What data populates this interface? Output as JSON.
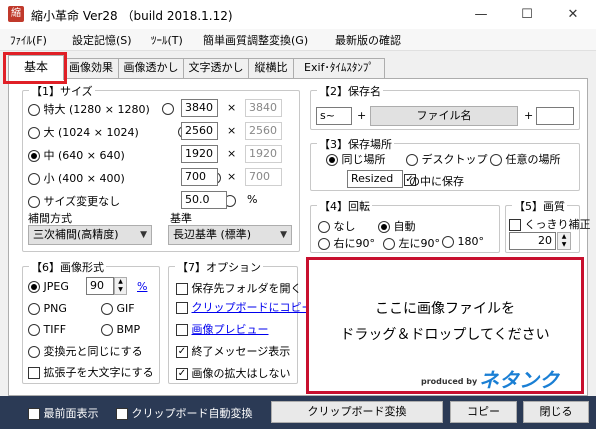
{
  "title": "縮小革命 Ver28 （build 2018.1.12)",
  "app_icon": "縮",
  "window_controls": {
    "minimize": "—",
    "maximize": "☐",
    "close": "✕"
  },
  "menu": [
    "ﾌｧｲﾙ(F)",
    "設定記憶(S)",
    "ﾂｰﾙ(T)",
    "簡単画質調整変換(G)",
    "最新版の確認"
  ],
  "tabs": [
    "基本",
    "画像効果",
    "画像透かし",
    "文字透かし",
    "縦横比",
    "Exif･ﾀｲﾑｽﾀﾝﾌﾟ"
  ],
  "size": {
    "title": "【1】サイズ",
    "presets": [
      "特大 (1280 × 1280)",
      "大 (1024 × 1024)",
      "中 (640 × 640)",
      "小 (400 × 400)",
      "サイズ変更なし"
    ],
    "selected_index": 2,
    "widths": [
      "3840",
      "2560",
      "1920",
      "700"
    ],
    "heights": [
      "3840",
      "2560",
      "1920",
      "700"
    ],
    "percent": "50.0",
    "times": "×",
    "percent_sign": "%"
  },
  "interp": {
    "title": "補間方式",
    "value": "三次補間(高精度)"
  },
  "basis": {
    "title": "基準",
    "value": "長辺基準 (標準)"
  },
  "save_name": {
    "title": "【2】保存名",
    "prefix": "s~",
    "plus": "+",
    "filename": "ファイル名",
    "suffix": ""
  },
  "save_place": {
    "title": "【3】保存場所",
    "options": [
      "同じ場所",
      "デスクトップ",
      "任意の場所"
    ],
    "selected_index": 0,
    "subfolder": "Resized",
    "subfolder_suffix": "の中に保存",
    "subfolder_checked": true
  },
  "rotate": {
    "title": "【4】回転",
    "options": [
      "なし",
      "自動",
      "右に90°",
      "左に90°",
      "180°"
    ],
    "selected_index": 1
  },
  "quality": {
    "title": "【5】画質",
    "sharpen_label": "くっきり補正",
    "value": "20"
  },
  "format": {
    "title": "【6】画像形式",
    "options": [
      "JPEG",
      "PNG",
      "GIF",
      "TIFF",
      "BMP",
      "変換元と同じにする"
    ],
    "selected_index": 0,
    "jpeg_quality": "90",
    "pct": "%",
    "uppercase_ext": "拡張子を大文字にする"
  },
  "options": {
    "title": "【7】オプション",
    "items": [
      {
        "label": "保存先フォルダを開く",
        "checked": false,
        "link": false
      },
      {
        "label": "クリップボードにコピー",
        "checked": false,
        "link": true
      },
      {
        "label": "画像プレビュー",
        "checked": false,
        "link": true
      },
      {
        "label": "終了メッセージ表示",
        "checked": true,
        "link": false
      },
      {
        "label": "画像の拡大はしない",
        "checked": true,
        "link": false
      }
    ]
  },
  "drop": {
    "line1": "ここに画像ファイルを",
    "line2": "ドラッグ＆ドロップしてください",
    "produced_by": "produced by",
    "brand": "ネタンク"
  },
  "bottom": {
    "topmost": "最前面表示",
    "clip_auto": "クリップボード自動変換",
    "clip_button": "クリップボード変換",
    "copy": "コピー",
    "close": "閉じる",
    "topmost_checked": true,
    "clip_auto_checked": false
  },
  "colors": {
    "highlight": "#e01f26",
    "bottom_bar": "#2b3a55",
    "link": "#0000ee",
    "brand_blue": "#1a7fd4"
  }
}
